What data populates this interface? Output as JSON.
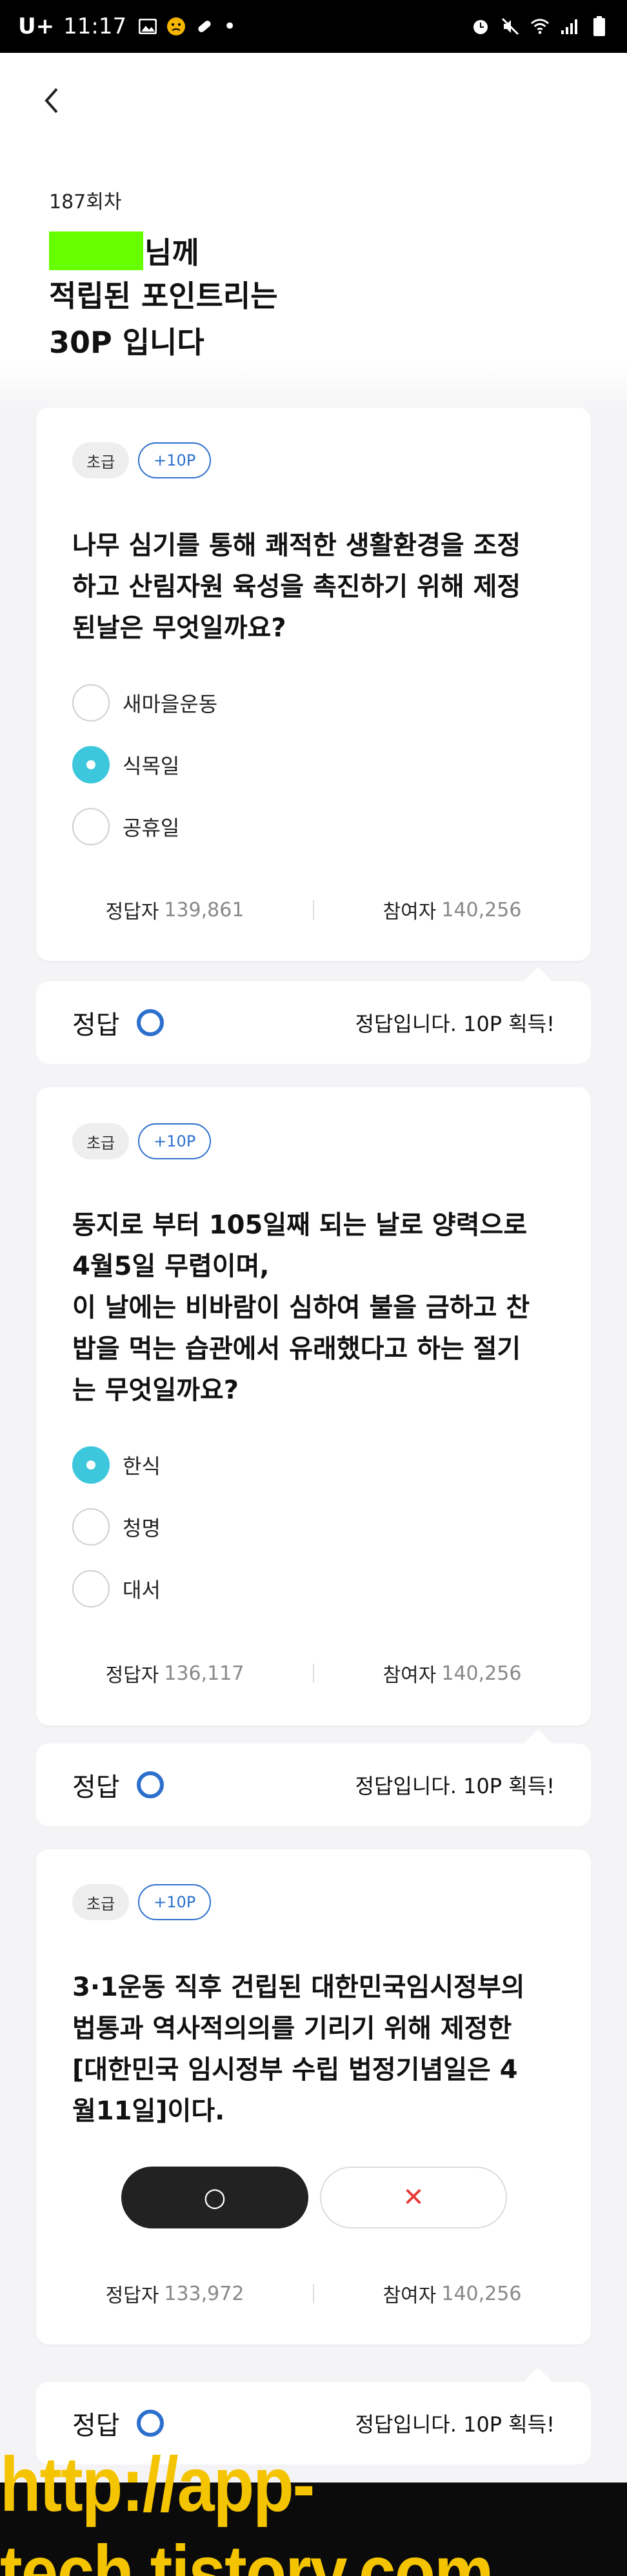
{
  "status_bar": {
    "carrier": "U+",
    "time": "11:17",
    "dot": "•"
  },
  "header": {
    "round": "187회차",
    "name_suffix": "님께",
    "line2": "적립된 포인트리는",
    "line3": "30P 입니다"
  },
  "quizzes": [
    {
      "level": "초급",
      "points": "+10P",
      "question_lines": [
        "나무 심기를 통해 쾌적한 생활환경을 조정",
        "하고 산림자원 육성을 촉진하기 위해 제정",
        "된날은 무엇일까요?"
      ],
      "options": [
        {
          "label": "새마을운동",
          "selected": false
        },
        {
          "label": "식목일",
          "selected": true
        },
        {
          "label": "공휴일",
          "selected": false
        }
      ],
      "correct_label": "정답자",
      "correct_count": "139,861",
      "participant_label": "참여자",
      "participant_count": "140,256",
      "answer_label": "정답",
      "answer_result": "정답입니다. 10P 획득!"
    },
    {
      "level": "초급",
      "points": "+10P",
      "question_lines": [
        "동지로 부터 105일째 되는 날로 양력으로",
        "4월5일 무렵이며,",
        "이 날에는 비바람이 심하여 불을 금하고 찬",
        "밥을 먹는 습관에서 유래했다고 하는 절기",
        "는 무엇일까요?"
      ],
      "options": [
        {
          "label": "한식",
          "selected": true
        },
        {
          "label": "청명",
          "selected": false
        },
        {
          "label": "대서",
          "selected": false
        }
      ],
      "correct_label": "정답자",
      "correct_count": "136,117",
      "participant_label": "참여자",
      "participant_count": "140,256",
      "answer_label": "정답",
      "answer_result": "정답입니다. 10P 획득!"
    },
    {
      "level": "초급",
      "points": "+10P",
      "question_lines": [
        "3·1운동 직후 건립된 대한민국임시정부의",
        "법통과 역사적의의를 기리기 위해 제정한",
        "[대한민국 임시정부 수립 법정기념일은 4",
        "월11일]이다."
      ],
      "o_label": "○",
      "x_label": "✕",
      "correct_label": "정답자",
      "correct_count": "133,972",
      "participant_label": "참여자",
      "participant_count": "140,256",
      "answer_label": "정답",
      "answer_result": "정답입니다. 10P 획득!"
    }
  ],
  "colors": {
    "accent_blue": "#2c6fcd",
    "selected_teal": "#3cc7dc",
    "redaction": "#66ff00"
  },
  "watermark": "http://app-tech.tistory.com"
}
